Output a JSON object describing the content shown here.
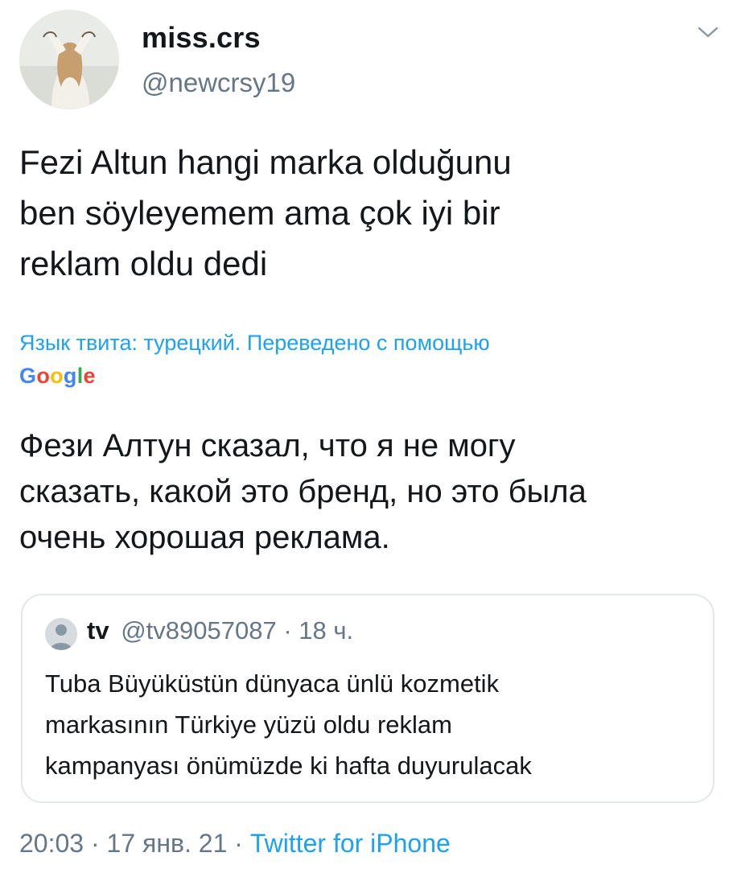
{
  "author": {
    "display_name": "miss.crs",
    "handle": "@newcrsy19",
    "avatar_icon": "profile-photo"
  },
  "menu_icon": "chevron-down-icon",
  "tweet": {
    "text": "Fezi Altun hangi marka olduğunu\nben söyleyemem ama çok iyi bir\nreklam oldu dedi",
    "translation_note": "Язык твита: турецкий. Переведено с помощью",
    "translation_provider": "Google",
    "translated_text": "Фези Алтун сказал, что я не могу\nсказать, какой это бренд, но это была\nочень хорошая реклама."
  },
  "quoted_tweet": {
    "name": "tv",
    "handle": "@tv89057087",
    "separator": "·",
    "time": "18 ч.",
    "text": "Tuba Büyüküstün dünyaca ünlü kozmetik\nmarkasının Türkiye yüzü oldu reklam\nkampanyası önümüzde ki hafta duyurulacak"
  },
  "meta": {
    "time": "20:03",
    "separator": " · ",
    "date": "17 янв. 21",
    "source": "Twitter for iPhone"
  },
  "colors": {
    "accent": "#1da1f2",
    "secondary_text": "#657786",
    "border": "#e1e8ed",
    "google_blue": "#4285f4",
    "google_red": "#ea4335",
    "google_yellow": "#fbbc05",
    "google_green": "#34a853"
  }
}
